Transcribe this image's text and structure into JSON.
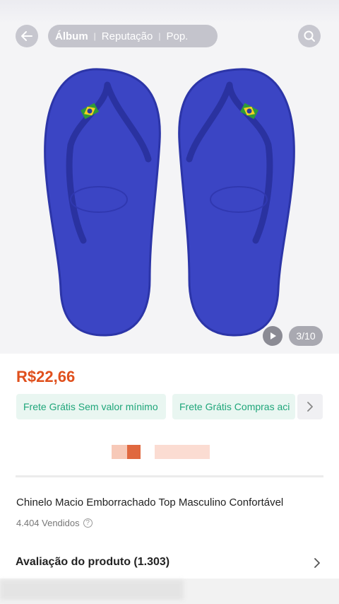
{
  "gallery": {
    "tabs": [
      {
        "label": "Álbum",
        "active": true
      },
      {
        "label": "Reputação",
        "active": false
      },
      {
        "label": "Pop.",
        "active": false
      }
    ],
    "counter": "3/10",
    "image_subject": "blue flip-flop sandals with Brazil flag",
    "icons": {
      "back": "back-arrow-icon",
      "search": "search-icon",
      "play": "play-icon"
    }
  },
  "product": {
    "price": "R$22,66",
    "shipping_chips": [
      "Frete Grátis Sem valor mínimo",
      "Frete Grátis Compras aci"
    ],
    "title": "Chinelo Macio Emborrachado Top Masculino Confortável",
    "sold": "4.404 Vendidos"
  },
  "reviews": {
    "label": "Avaliação do produto (1.303)"
  },
  "colors": {
    "price": "#e0501d",
    "chip_text": "#1fa67a",
    "chip_bg": "#e9f6f1",
    "sandal": "#3b45c4"
  }
}
